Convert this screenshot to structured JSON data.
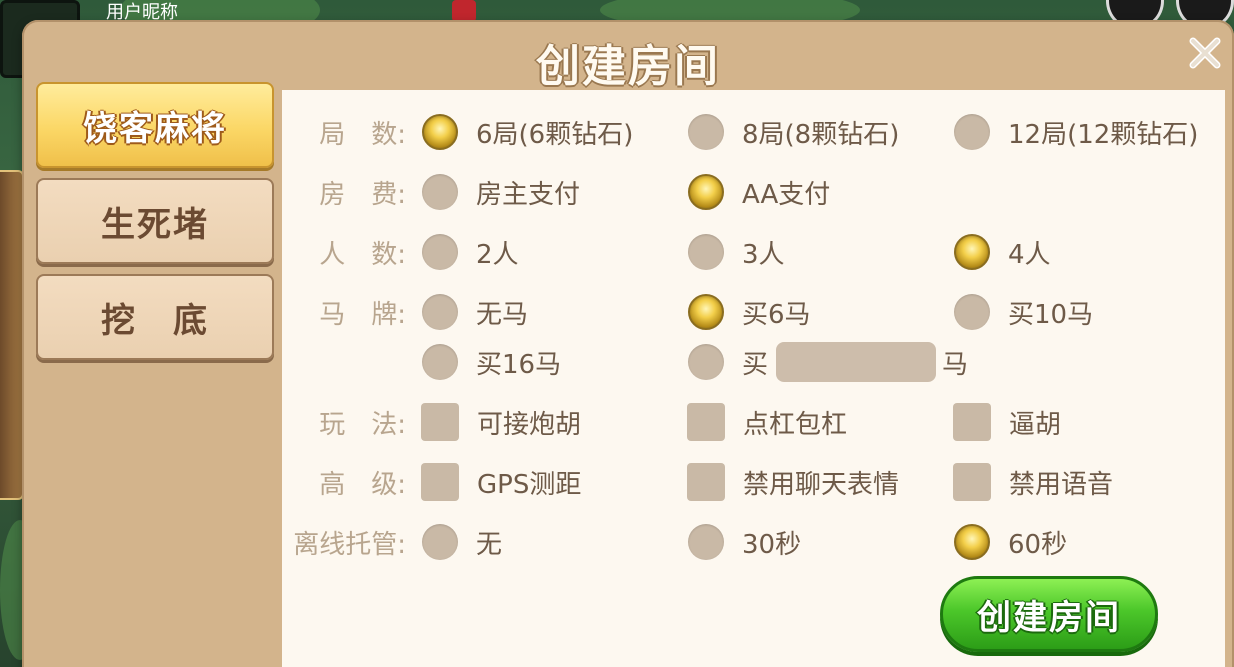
{
  "background": {
    "nickname": "用户昵称"
  },
  "dialog": {
    "title": "创建房间"
  },
  "tabs": [
    {
      "label": "饶客麻将",
      "active": true
    },
    {
      "label": "生死堵",
      "active": false
    },
    {
      "label": "挖　底",
      "active": false
    }
  ],
  "rows": {
    "rounds": {
      "label": "局　数:",
      "options": [
        {
          "label": "6局(6颗钻石)",
          "selected": true
        },
        {
          "label": "8局(8颗钻石)",
          "selected": false
        },
        {
          "label": "12局(12颗钻石)",
          "selected": false
        }
      ]
    },
    "fee": {
      "label": "房　费:",
      "options": [
        {
          "label": "房主支付",
          "selected": false
        },
        {
          "label": "AA支付",
          "selected": true
        }
      ]
    },
    "players": {
      "label": "人　数:",
      "options": [
        {
          "label": "2人",
          "selected": false
        },
        {
          "label": "3人",
          "selected": false
        },
        {
          "label": "4人",
          "selected": true
        }
      ]
    },
    "horses": {
      "label": "马　牌:",
      "options": [
        {
          "label": "无马",
          "selected": false
        },
        {
          "label": "买6马",
          "selected": true
        },
        {
          "label": "买10马",
          "selected": false
        },
        {
          "label": "买16马",
          "selected": false
        }
      ],
      "custom": {
        "prefix": "买",
        "suffix": "马",
        "value": "",
        "selected": false
      }
    },
    "rules": {
      "label": "玩　法:",
      "options": [
        {
          "label": "可接炮胡",
          "checked": false
        },
        {
          "label": "点杠包杠",
          "checked": false
        },
        {
          "label": "逼胡",
          "checked": false
        }
      ]
    },
    "advanced": {
      "label": "高　级:",
      "options": [
        {
          "label": "GPS测距",
          "checked": false
        },
        {
          "label": "禁用聊天表情",
          "checked": false
        },
        {
          "label": "禁用语音",
          "checked": false
        }
      ]
    },
    "offline": {
      "label": "离线托管:",
      "options": [
        {
          "label": "无",
          "selected": false
        },
        {
          "label": "30秒",
          "selected": false
        },
        {
          "label": "60秒",
          "selected": true
        }
      ]
    }
  },
  "create_button": {
    "label": "创建房间"
  },
  "colors": {
    "panel_bg": "#fdf8f0",
    "frame": "#d3b48c",
    "label": "#b8a58e",
    "option_text": "#6e5a48",
    "accent_green": "#4cc72a",
    "tab_active": "#fbd766"
  }
}
